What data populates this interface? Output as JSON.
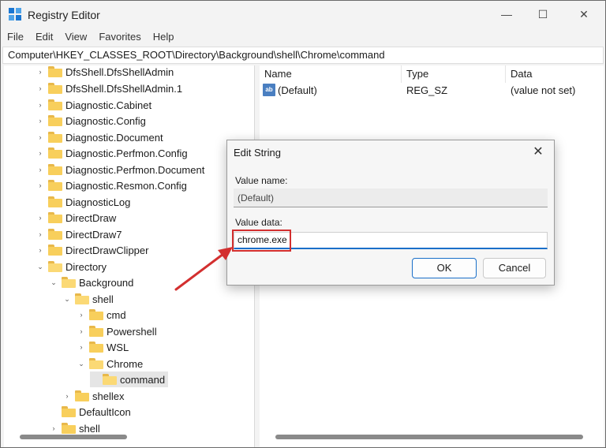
{
  "window": {
    "title": "Registry Editor",
    "controls": {
      "minimize": "—",
      "maximize": "☐",
      "close": "✕"
    }
  },
  "menu": [
    "File",
    "Edit",
    "View",
    "Favorites",
    "Help"
  ],
  "address": "Computer\\HKEY_CLASSES_ROOT\\Directory\\Background\\shell\\Chrome\\command",
  "tree": {
    "items": [
      {
        "label": "DfsShell.DfsShellAdmin",
        "chevron": "›"
      },
      {
        "label": "DfsShell.DfsShellAdmin.1",
        "chevron": "›"
      },
      {
        "label": "Diagnostic.Cabinet",
        "chevron": "›"
      },
      {
        "label": "Diagnostic.Config",
        "chevron": "›"
      },
      {
        "label": "Diagnostic.Document",
        "chevron": "›"
      },
      {
        "label": "Diagnostic.Perfmon.Config",
        "chevron": "›"
      },
      {
        "label": "Diagnostic.Perfmon.Document",
        "chevron": "›"
      },
      {
        "label": "Diagnostic.Resmon.Config",
        "chevron": "›"
      },
      {
        "label": "DiagnosticLog",
        "chevron": ""
      },
      {
        "label": "DirectDraw",
        "chevron": "›"
      },
      {
        "label": "DirectDraw7",
        "chevron": "›"
      },
      {
        "label": "DirectDrawClipper",
        "chevron": "›"
      },
      {
        "label": "Directory",
        "chevron": "⌄"
      },
      {
        "label": "Background",
        "chevron": "⌄"
      },
      {
        "label": "shell",
        "chevron": "⌄"
      },
      {
        "label": "cmd",
        "chevron": "›"
      },
      {
        "label": "Powershell",
        "chevron": "›"
      },
      {
        "label": "WSL",
        "chevron": "›"
      },
      {
        "label": "Chrome",
        "chevron": "⌄"
      },
      {
        "label": "command",
        "chevron": ""
      },
      {
        "label": "shellex",
        "chevron": "›"
      },
      {
        "label": "DefaultIcon",
        "chevron": ""
      },
      {
        "label": "shell",
        "chevron": "›"
      }
    ]
  },
  "list": {
    "columns": [
      "Name",
      "Type",
      "Data"
    ],
    "rows": [
      {
        "icon": "ab",
        "name": "(Default)",
        "type": "REG_SZ",
        "data": "(value not set)"
      }
    ]
  },
  "dialog": {
    "title": "Edit String",
    "close": "✕",
    "value_name_label": "Value name:",
    "value_name": "(Default)",
    "value_data_label": "Value data:",
    "value_data": "chrome.exe",
    "ok_label": "OK",
    "cancel_label": "Cancel"
  },
  "annotation": {
    "color": "#d32f2f"
  },
  "colors": {
    "accent": "#1a6fc9",
    "folder": "#f8cf5c"
  }
}
